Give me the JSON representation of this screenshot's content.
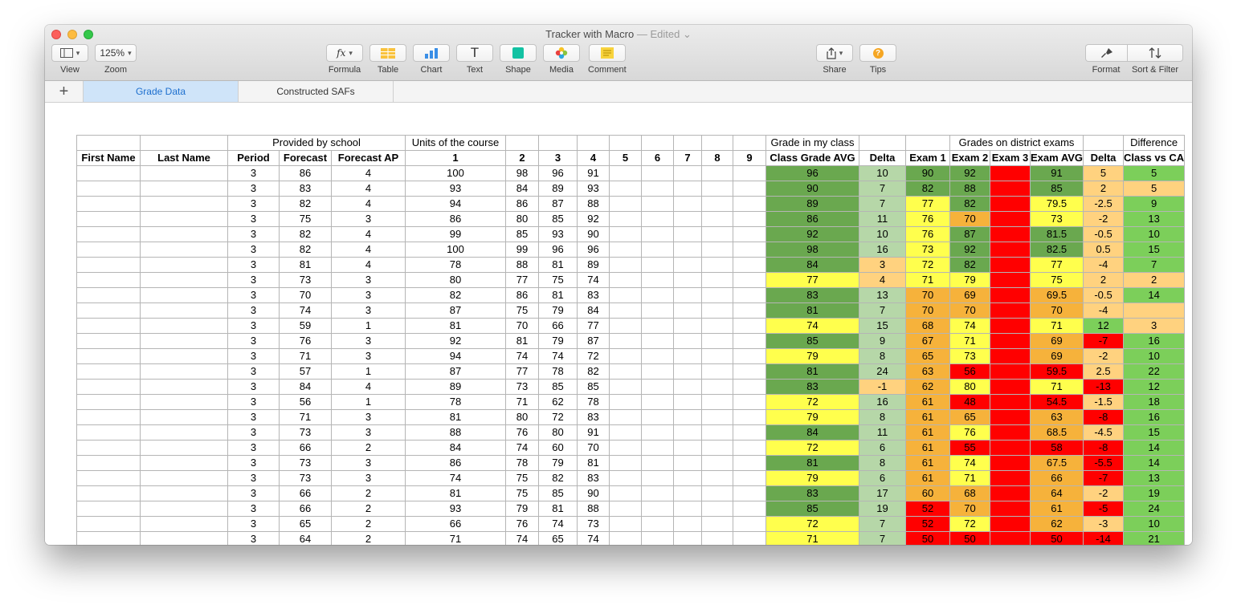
{
  "window": {
    "title": "Tracker with Macro",
    "title_status": "— Edited"
  },
  "toolbar": {
    "view": "View",
    "zoom_value": "125%",
    "zoom": "Zoom",
    "formula": "Formula",
    "formula_glyph": "fx",
    "table": "Table",
    "chart": "Chart",
    "text": "Text",
    "text_glyph": "T",
    "shape": "Shape",
    "media": "Media",
    "comment": "Comment",
    "share": "Share",
    "tips": "Tips",
    "tips_glyph": "?",
    "format": "Format",
    "sort_filter": "Sort & Filter"
  },
  "sheets": {
    "add": "+",
    "tabs": [
      "Grade Data",
      "Constructed SAFs"
    ],
    "active": 0
  },
  "table": {
    "group_headers": {
      "provided": "Provided by school",
      "units": "Units of the course",
      "grade_class": "Grade in my class",
      "district": "Grades on district exams",
      "difference": "Difference"
    },
    "headers": [
      "First Name",
      "Last Name",
      "Period",
      "Forecast",
      "Forecast AP",
      "1",
      "2",
      "3",
      "4",
      "5",
      "6",
      "7",
      "8",
      "9",
      "Class Grade AVG",
      "Delta",
      "Exam 1",
      "Exam 2",
      "Exam 3",
      "Exam AVG",
      "Delta",
      "Class vs CA"
    ],
    "rows": [
      [
        "",
        "",
        "3",
        "86",
        "4",
        "100",
        "98",
        "96",
        "91",
        "",
        "",
        "",
        "",
        "",
        "96",
        "10",
        "90",
        "92",
        "",
        "91",
        "5",
        "5"
      ],
      [
        "",
        "",
        "3",
        "83",
        "4",
        "93",
        "84",
        "89",
        "93",
        "",
        "",
        "",
        "",
        "",
        "90",
        "7",
        "82",
        "88",
        "",
        "85",
        "2",
        "5"
      ],
      [
        "",
        "",
        "3",
        "82",
        "4",
        "94",
        "86",
        "87",
        "88",
        "",
        "",
        "",
        "",
        "",
        "89",
        "7",
        "77",
        "82",
        "",
        "79.5",
        "-2.5",
        "9"
      ],
      [
        "",
        "",
        "3",
        "75",
        "3",
        "86",
        "80",
        "85",
        "92",
        "",
        "",
        "",
        "",
        "",
        "86",
        "11",
        "76",
        "70",
        "",
        "73",
        "-2",
        "13"
      ],
      [
        "",
        "",
        "3",
        "82",
        "4",
        "99",
        "85",
        "93",
        "90",
        "",
        "",
        "",
        "",
        "",
        "92",
        "10",
        "76",
        "87",
        "",
        "81.5",
        "-0.5",
        "10"
      ],
      [
        "",
        "",
        "3",
        "82",
        "4",
        "100",
        "99",
        "96",
        "96",
        "",
        "",
        "",
        "",
        "",
        "98",
        "16",
        "73",
        "92",
        "",
        "82.5",
        "0.5",
        "15"
      ],
      [
        "",
        "",
        "3",
        "81",
        "4",
        "78",
        "88",
        "81",
        "89",
        "",
        "",
        "",
        "",
        "",
        "84",
        "3",
        "72",
        "82",
        "",
        "77",
        "-4",
        "7"
      ],
      [
        "",
        "",
        "3",
        "73",
        "3",
        "80",
        "77",
        "75",
        "74",
        "",
        "",
        "",
        "",
        "",
        "77",
        "4",
        "71",
        "79",
        "",
        "75",
        "2",
        "2"
      ],
      [
        "",
        "",
        "3",
        "70",
        "3",
        "82",
        "86",
        "81",
        "83",
        "",
        "",
        "",
        "",
        "",
        "83",
        "13",
        "70",
        "69",
        "",
        "69.5",
        "-0.5",
        "14"
      ],
      [
        "",
        "",
        "3",
        "74",
        "3",
        "87",
        "75",
        "79",
        "84",
        "",
        "",
        "",
        "",
        "",
        "81",
        "7",
        "70",
        "70",
        "",
        "70",
        "-4",
        ""
      ],
      [
        "",
        "",
        "3",
        "59",
        "1",
        "81",
        "70",
        "66",
        "77",
        "",
        "",
        "",
        "",
        "",
        "74",
        "15",
        "68",
        "74",
        "",
        "71",
        "12",
        "3"
      ],
      [
        "",
        "",
        "3",
        "76",
        "3",
        "92",
        "81",
        "79",
        "87",
        "",
        "",
        "",
        "",
        "",
        "85",
        "9",
        "67",
        "71",
        "",
        "69",
        "-7",
        "16"
      ],
      [
        "",
        "",
        "3",
        "71",
        "3",
        "94",
        "74",
        "74",
        "72",
        "",
        "",
        "",
        "",
        "",
        "79",
        "8",
        "65",
        "73",
        "",
        "69",
        "-2",
        "10"
      ],
      [
        "",
        "",
        "3",
        "57",
        "1",
        "87",
        "77",
        "78",
        "82",
        "",
        "",
        "",
        "",
        "",
        "81",
        "24",
        "63",
        "56",
        "",
        "59.5",
        "2.5",
        "22"
      ],
      [
        "",
        "",
        "3",
        "84",
        "4",
        "89",
        "73",
        "85",
        "85",
        "",
        "",
        "",
        "",
        "",
        "83",
        "-1",
        "62",
        "80",
        "",
        "71",
        "-13",
        "12"
      ],
      [
        "",
        "",
        "3",
        "56",
        "1",
        "78",
        "71",
        "62",
        "78",
        "",
        "",
        "",
        "",
        "",
        "72",
        "16",
        "61",
        "48",
        "",
        "54.5",
        "-1.5",
        "18"
      ],
      [
        "",
        "",
        "3",
        "71",
        "3",
        "81",
        "80",
        "72",
        "83",
        "",
        "",
        "",
        "",
        "",
        "79",
        "8",
        "61",
        "65",
        "",
        "63",
        "-8",
        "16"
      ],
      [
        "",
        "",
        "3",
        "73",
        "3",
        "88",
        "76",
        "80",
        "91",
        "",
        "",
        "",
        "",
        "",
        "84",
        "11",
        "61",
        "76",
        "",
        "68.5",
        "-4.5",
        "15"
      ],
      [
        "",
        "",
        "3",
        "66",
        "2",
        "84",
        "74",
        "60",
        "70",
        "",
        "",
        "",
        "",
        "",
        "72",
        "6",
        "61",
        "55",
        "",
        "58",
        "-8",
        "14"
      ],
      [
        "",
        "",
        "3",
        "73",
        "3",
        "86",
        "78",
        "79",
        "81",
        "",
        "",
        "",
        "",
        "",
        "81",
        "8",
        "61",
        "74",
        "",
        "67.5",
        "-5.5",
        "14"
      ],
      [
        "",
        "",
        "3",
        "73",
        "3",
        "74",
        "75",
        "82",
        "83",
        "",
        "",
        "",
        "",
        "",
        "79",
        "6",
        "61",
        "71",
        "",
        "66",
        "-7",
        "13"
      ],
      [
        "",
        "",
        "3",
        "66",
        "2",
        "81",
        "75",
        "85",
        "90",
        "",
        "",
        "",
        "",
        "",
        "83",
        "17",
        "60",
        "68",
        "",
        "64",
        "-2",
        "19"
      ],
      [
        "",
        "",
        "3",
        "66",
        "2",
        "93",
        "79",
        "81",
        "88",
        "",
        "",
        "",
        "",
        "",
        "85",
        "19",
        "52",
        "70",
        "",
        "61",
        "-5",
        "24"
      ],
      [
        "",
        "",
        "3",
        "65",
        "2",
        "66",
        "76",
        "74",
        "73",
        "",
        "",
        "",
        "",
        "",
        "72",
        "7",
        "52",
        "72",
        "",
        "62",
        "-3",
        "10"
      ],
      [
        "",
        "",
        "3",
        "64",
        "2",
        "71",
        "74",
        "65",
        "74",
        "",
        "",
        "",
        "",
        "",
        "71",
        "7",
        "50",
        "50",
        "",
        "50",
        "-14",
        "21"
      ],
      [
        "",
        "",
        "",
        "",
        "",
        "",
        "",
        "",
        "",
        "",
        "",
        "",
        "",
        "",
        "",
        "",
        "",
        "",
        "",
        "",
        "",
        ""
      ]
    ],
    "row_colors": [
      [
        "dg",
        "lg",
        "dg",
        "dg",
        "r",
        "dg",
        "lo",
        "gr"
      ],
      [
        "dg",
        "lg",
        "dg",
        "dg",
        "r",
        "dg",
        "lo",
        "lo"
      ],
      [
        "dg",
        "lg",
        "y",
        "dg",
        "r",
        "y",
        "lo",
        "gr"
      ],
      [
        "dg",
        "lg",
        "y",
        "o",
        "r",
        "y",
        "lo",
        "gr"
      ],
      [
        "dg",
        "lg",
        "y",
        "dg",
        "r",
        "dg",
        "lo",
        "gr"
      ],
      [
        "dg",
        "lg",
        "y",
        "dg",
        "r",
        "dg",
        "lo",
        "gr"
      ],
      [
        "dg",
        "lo",
        "y",
        "dg",
        "r",
        "y",
        "lo",
        "gr"
      ],
      [
        "y",
        "lo",
        "y",
        "y",
        "r",
        "y",
        "lo",
        "lo"
      ],
      [
        "dg",
        "lg",
        "o",
        "o",
        "r",
        "o",
        "lo",
        "gr"
      ],
      [
        "dg",
        "lg",
        "o",
        "o",
        "r",
        "o",
        "lo",
        "lo"
      ],
      [
        "y",
        "lg",
        "o",
        "y",
        "r",
        "y",
        "gr",
        "lo"
      ],
      [
        "dg",
        "lg",
        "o",
        "y",
        "r",
        "o",
        "r",
        "gr"
      ],
      [
        "y",
        "lg",
        "o",
        "y",
        "r",
        "o",
        "lo",
        "gr"
      ],
      [
        "dg",
        "lg",
        "o",
        "r",
        "r",
        "r",
        "lo",
        "gr"
      ],
      [
        "dg",
        "lo",
        "o",
        "y",
        "r",
        "y",
        "r",
        "gr"
      ],
      [
        "y",
        "lg",
        "o",
        "r",
        "r",
        "r",
        "lo",
        "gr"
      ],
      [
        "y",
        "lg",
        "o",
        "o",
        "r",
        "o",
        "r",
        "gr"
      ],
      [
        "dg",
        "lg",
        "o",
        "y",
        "r",
        "o",
        "lo",
        "gr"
      ],
      [
        "y",
        "lg",
        "o",
        "r",
        "r",
        "r",
        "r",
        "gr"
      ],
      [
        "dg",
        "lg",
        "o",
        "y",
        "r",
        "o",
        "r",
        "gr"
      ],
      [
        "y",
        "lg",
        "o",
        "y",
        "r",
        "o",
        "r",
        "gr"
      ],
      [
        "dg",
        "lg",
        "o",
        "o",
        "r",
        "o",
        "lo",
        "gr"
      ],
      [
        "dg",
        "lg",
        "r",
        "o",
        "r",
        "o",
        "r",
        "gr"
      ],
      [
        "y",
        "lg",
        "r",
        "y",
        "r",
        "o",
        "lo",
        "gr"
      ],
      [
        "y",
        "lg",
        "r",
        "r",
        "r",
        "r",
        "r",
        "gr"
      ],
      [
        "r",
        "lo",
        "r",
        "r",
        "r",
        "r",
        "r",
        "gr"
      ]
    ]
  }
}
